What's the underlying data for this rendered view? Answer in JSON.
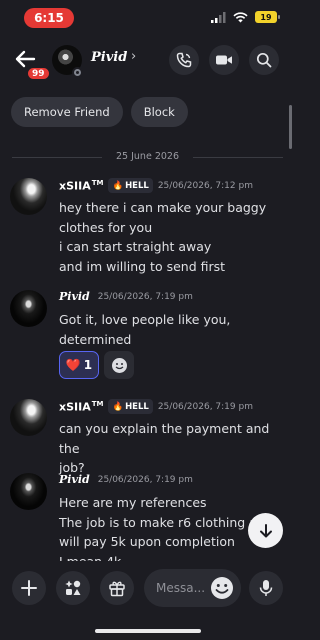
{
  "status_bar": {
    "time": "6:15",
    "battery": "19"
  },
  "header": {
    "badge": "99",
    "username": "Pivid",
    "chevron": "›"
  },
  "actions": {
    "remove_friend": "Remove Friend",
    "block": "Block"
  },
  "date_divider": "25 June 2026",
  "messages": [
    {
      "author": "xSIIA",
      "tm": "TM",
      "tag": "HELL",
      "time": "25/06/2026, 7:12 pm",
      "lines": [
        "hey there i can make your baggy",
        "clothes for you",
        "i can start straight away",
        "and im willing to send first"
      ]
    },
    {
      "author": "Pivid",
      "time": "25/06/2026, 7:19 pm",
      "lines": [
        "Got it, love people like you,",
        "determined"
      ],
      "reaction": {
        "emoji": "❤️",
        "count": "1"
      }
    },
    {
      "author": "xSIIA",
      "tm": "TM",
      "tag": "HELL",
      "time": "25/06/2026, 7:19 pm",
      "lines": [
        "can you explain the payment and the",
        "job?"
      ]
    },
    {
      "author": "Pivid",
      "time": "25/06/2026, 7:19 pm",
      "lines": [
        "Here are my references",
        "The job is to make r6 clothing and",
        "will pay 5k upon completion",
        "I mean 4k"
      ]
    }
  ],
  "composer": {
    "placeholder": "Messa..."
  },
  "colors": {
    "accent": "#5865f2",
    "danger": "#e53935",
    "battery": "#f2d22b"
  }
}
